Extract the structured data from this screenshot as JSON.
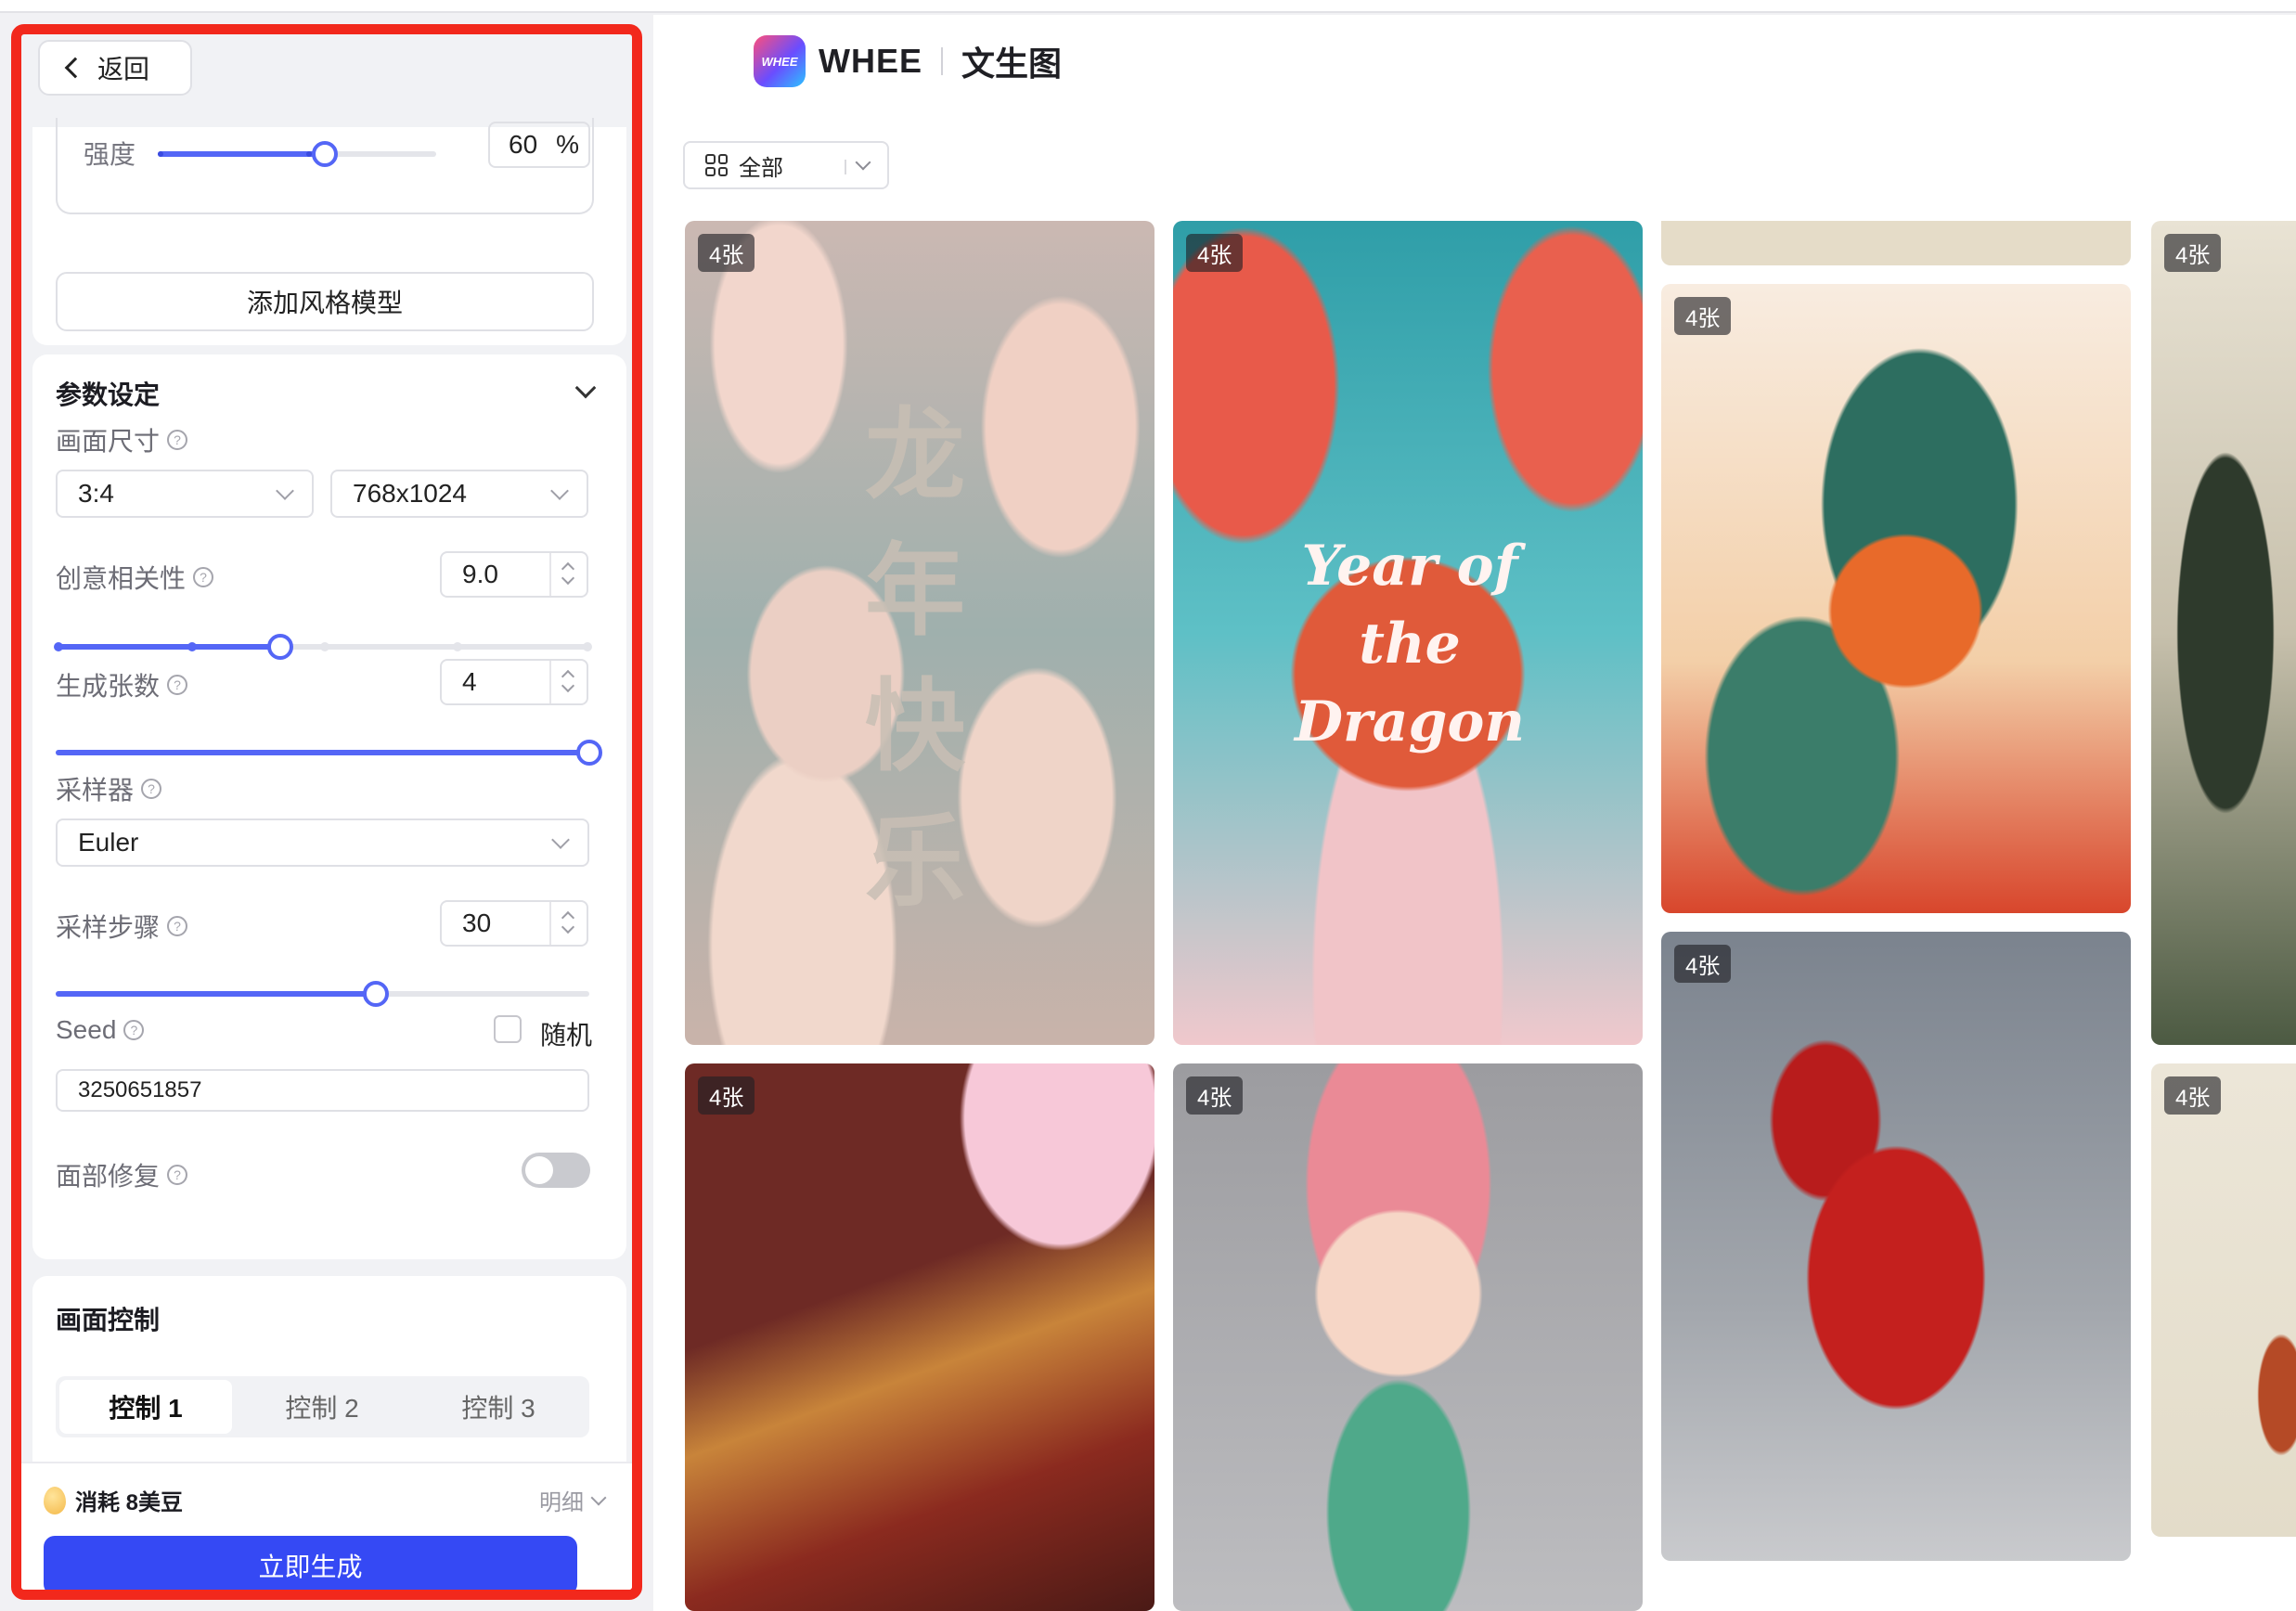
{
  "nav": {
    "back_label": "返回"
  },
  "style_model": {
    "strength_label": "强度",
    "strength_value": "60",
    "strength_unit": "%",
    "strength_level": 0.6,
    "add_button": "添加风格模型"
  },
  "params": {
    "title": "参数设定",
    "size_label": "画面尺寸",
    "aspect_value": "3:4",
    "resolution_value": "768x1024",
    "creativity_label": "创意相关性",
    "creativity_value": "9.0",
    "creativity_level": 0.42,
    "count_label": "生成张数",
    "count_value": "4",
    "count_level": 1.0,
    "sampler_label": "采样器",
    "sampler_value": "Euler",
    "steps_label": "采样步骤",
    "steps_value": "30",
    "steps_level": 0.6,
    "seed_label": "Seed",
    "random_label": "随机",
    "seed_value": "3250651857",
    "face_fix_label": "面部修复",
    "help_glyph": "?"
  },
  "control": {
    "title": "画面控制",
    "tabs": [
      "控制 1",
      "控制 2",
      "控制 3"
    ],
    "active_tab": 0
  },
  "footer": {
    "cost_label": "消耗 8美豆",
    "detail_label": "明细",
    "generate_button": "立即生成"
  },
  "header": {
    "logo_text": "WHEE",
    "brand": "WHEE",
    "page_title": "文生图"
  },
  "gallery": {
    "filter_label": "全部",
    "badge": "4张",
    "tiles": [
      {
        "name": "clouds-longnian-kuaile",
        "text": "龙年快乐"
      },
      {
        "name": "year-of-the-dragon-balloon",
        "text": "Year of the Dragon"
      },
      {
        "name": "boy-with-dragon-illustration",
        "text": ""
      },
      {
        "name": "temple-landscape",
        "text": ""
      },
      {
        "name": "golden-dragon-temple",
        "text": ""
      },
      {
        "name": "cartoon-kid-pink-hat",
        "text": ""
      },
      {
        "name": "lego-red-dragon",
        "text": ""
      },
      {
        "name": "ink-dragon-figure",
        "text": ""
      }
    ]
  },
  "colors": {
    "accent": "#3549f4",
    "slider": "#5466f6",
    "highlight_frame": "#f2281c"
  }
}
